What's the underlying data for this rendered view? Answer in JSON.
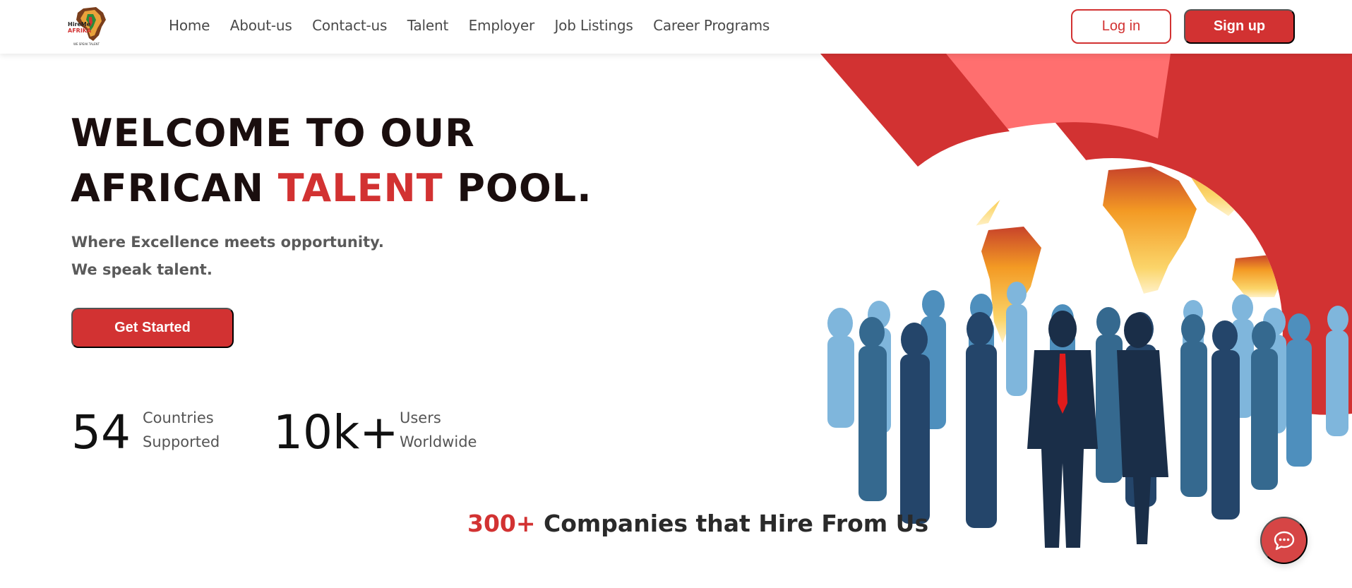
{
  "brand": {
    "logo_line1": "HireMe",
    "logo_line2": "AFRIKA",
    "logo_tagline": "WE SPEAK TALENT"
  },
  "nav": {
    "links": [
      "Home",
      "About-us",
      "Contact-us",
      "Talent",
      "Employer",
      "Job Listings",
      "Career Programs"
    ],
    "login_label": "Log in",
    "signup_label": "Sign up"
  },
  "hero": {
    "title_line1": "WELCOME TO OUR",
    "title_line2_pre": "AFRICAN ",
    "title_line2_accent": "TALENT",
    "title_line2_post": " POOL.",
    "subtitle_line1": "Where Excellence meets opportunity.",
    "subtitle_line2": "We speak talent.",
    "cta_label": "Get Started"
  },
  "stats": [
    {
      "value": "54",
      "label_line1": "Countries",
      "label_line2": "Supported"
    },
    {
      "value": "10k+",
      "label_line1": "Users",
      "label_line2": "Worldwide"
    }
  ],
  "companies": {
    "count": "300+",
    "text": " Companies that Hire From Us"
  },
  "colors": {
    "accent": "#d23232",
    "accent_light": "#ff6f6f",
    "globe_orange": "#f5a024",
    "text_dark": "#1a0e0e"
  },
  "icons": {
    "chat": "chat-bubble-icon"
  }
}
